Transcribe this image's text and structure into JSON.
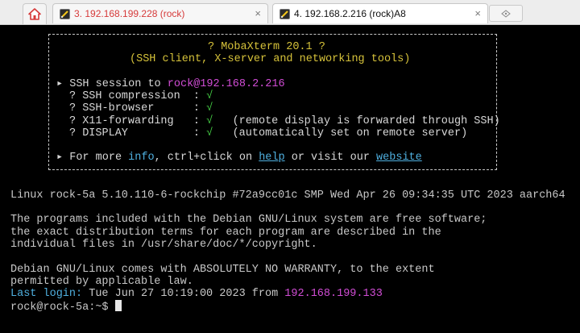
{
  "tabs": [
    {
      "label": "3. 192.168.199.228 (rock)",
      "close": "×",
      "color": "#d63a3a"
    },
    {
      "label": "4. 192.168.2.216 (rock)A8",
      "close": "×",
      "color": "#111111"
    }
  ],
  "banner": {
    "title": "? MobaXterm 20.1 ?",
    "subtitle": "(SSH client, X-server and networking tools)",
    "session_prefix": "SSH session to",
    "session_user": "rock",
    "session_host": "@192.168.2.216",
    "features": [
      {
        "label": "? SSH compression  :",
        "mark": "√",
        "note": ""
      },
      {
        "label": "? SSH-browser      :",
        "mark": "√",
        "note": ""
      },
      {
        "label": "? X11-forwarding   :",
        "mark": "√",
        "note": "(remote display is forwarded through SSH)"
      },
      {
        "label": "? DISPLAY          :",
        "mark": "√",
        "note": "(automatically set on remote server)"
      }
    ],
    "more_prefix": "For more",
    "more_info": "info",
    "more_mid": ", ctrl+click on",
    "more_help": "help",
    "more_or": "or visit our",
    "more_website": "website"
  },
  "terminal": {
    "uname": "Linux rock-5a 5.10.110-6-rockchip #72a9cc01c SMP Wed Apr 26 09:34:35 UTC 2023 aarch64",
    "motd1": "The programs included with the Debian GNU/Linux system are free software;",
    "motd2": "the exact distribution terms for each program are described in the",
    "motd3": "individual files in /usr/share/doc/*/copyright.",
    "motd4": "Debian GNU/Linux comes with ABSOLUTELY NO WARRANTY, to the extent",
    "motd5": "permitted by applicable law.",
    "last_login_label": "Last login:",
    "last_login_text": "Tue Jun 27 10:19:00 2023 from",
    "last_login_ip": "192.168.199.133",
    "prompt": "rock@rock-5a:~$"
  }
}
